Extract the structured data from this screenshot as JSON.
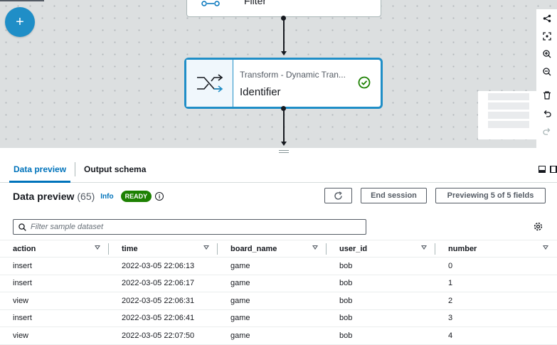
{
  "canvas": {
    "add_label": "+",
    "filter_node": {
      "label": "Filter",
      "icon": "filter-icon"
    },
    "transform_node": {
      "type": "Transform - Dynamic Tran...",
      "name": "Identifier",
      "icon": "shuffle-icon",
      "status_icon": "check-circle-icon"
    },
    "toolbar": [
      "share-icon",
      "fit-view-icon",
      "zoom-in-icon",
      "zoom-out-icon",
      "delete-icon",
      "undo-icon",
      "redo-icon"
    ]
  },
  "panel": {
    "tabs": [
      {
        "label": "Data preview",
        "active": true
      },
      {
        "label": "Output schema",
        "active": false
      }
    ],
    "header": {
      "title": "Data preview",
      "count": "(65)",
      "info": "Info",
      "status": "READY"
    },
    "buttons": {
      "end_session": "End session",
      "previewing": "Previewing 5 of 5 fields"
    },
    "search": {
      "placeholder": "Filter sample dataset",
      "value": ""
    },
    "table": {
      "columns": [
        "action",
        "time",
        "board_name",
        "user_id",
        "number"
      ],
      "rows": [
        [
          "insert",
          "2022-03-05 22:06:13",
          "game",
          "bob",
          "0"
        ],
        [
          "insert",
          "2022-03-05 22:06:17",
          "game",
          "bob",
          "1"
        ],
        [
          "view",
          "2022-03-05 22:06:31",
          "game",
          "bob",
          "2"
        ],
        [
          "insert",
          "2022-03-05 22:06:41",
          "game",
          "bob",
          "3"
        ],
        [
          "view",
          "2022-03-05 22:07:50",
          "game",
          "bob",
          "4"
        ]
      ]
    }
  },
  "colors": {
    "accent": "#0073bb",
    "node_border": "#1f8ec7",
    "ready_badge": "#1d8102"
  }
}
